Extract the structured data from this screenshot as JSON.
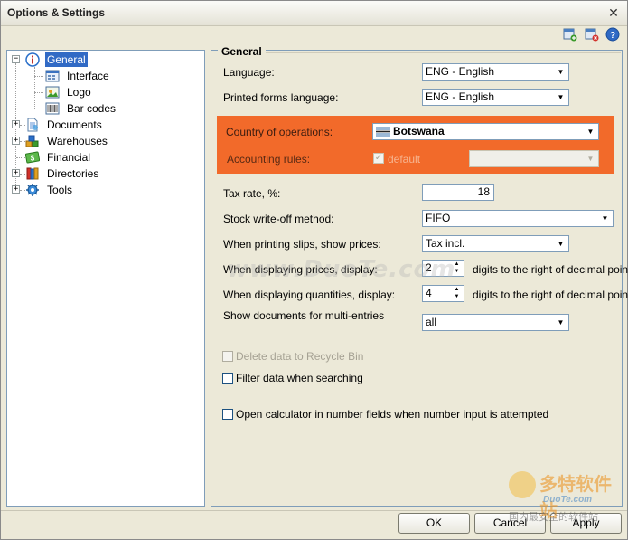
{
  "window": {
    "title": "Options & Settings",
    "close_glyph": "✕"
  },
  "toolbar": {
    "icons": [
      "add-settings-icon",
      "delete-settings-icon",
      "help-icon"
    ]
  },
  "tree": {
    "items": [
      {
        "label": "General",
        "icon": "info-icon",
        "expander": "−"
      },
      {
        "label": "Interface",
        "icon": "interface-icon"
      },
      {
        "label": "Logo",
        "icon": "logo-icon"
      },
      {
        "label": "Bar codes",
        "icon": "barcode-icon"
      },
      {
        "label": "Documents",
        "icon": "documents-icon",
        "expander": "+"
      },
      {
        "label": "Warehouses",
        "icon": "warehouses-icon",
        "expander": "+"
      },
      {
        "label": "Financial",
        "icon": "financial-icon"
      },
      {
        "label": "Directories",
        "icon": "directories-icon",
        "expander": "+"
      },
      {
        "label": "Tools",
        "icon": "tools-icon",
        "expander": "+"
      }
    ]
  },
  "general": {
    "title": "General",
    "language": {
      "label": "Language:",
      "value": "ENG - English"
    },
    "printed_language": {
      "label": "Printed forms language:",
      "value": "ENG - English"
    },
    "country": {
      "label": "Country of operations:",
      "value": "Botswana"
    },
    "accounting": {
      "label": "Accounting rules:",
      "checkbox_label": "default",
      "value": ""
    },
    "tax_rate": {
      "label": "Tax rate, %:",
      "value": "18"
    },
    "stock_writeoff": {
      "label": "Stock write-off method:",
      "value": "FIFO"
    },
    "slip_prices": {
      "label": "When printing slips, show prices:",
      "value": "Tax incl."
    },
    "price_decimals": {
      "label": "When displaying prices, display:",
      "value": "2",
      "suffix": "digits to the right of decimal point"
    },
    "qty_decimals": {
      "label": "When displaying quantities, display:",
      "value": "4",
      "suffix": "digits to the right of decimal point"
    },
    "multi_entries": {
      "label": "Show documents for multi-entries",
      "value": "all"
    },
    "recycle_bin": {
      "label": "Delete data to Recycle Bin"
    },
    "filter_search": {
      "label": "Filter data when searching"
    },
    "calculator": {
      "label": "Open calculator in number fields when number input is attempted"
    }
  },
  "buttons": {
    "ok": "OK",
    "cancel": "Cancel",
    "apply": "Apply"
  },
  "watermark": {
    "text": "www.DuoTe.com",
    "logo_main": "多特软件站",
    "logo_sub": "DuoTe.com",
    "logo_slogan": "国内最安全的软件站"
  },
  "colors": {
    "accent_orange": "#f26a2a",
    "selection": "#316ac5"
  }
}
